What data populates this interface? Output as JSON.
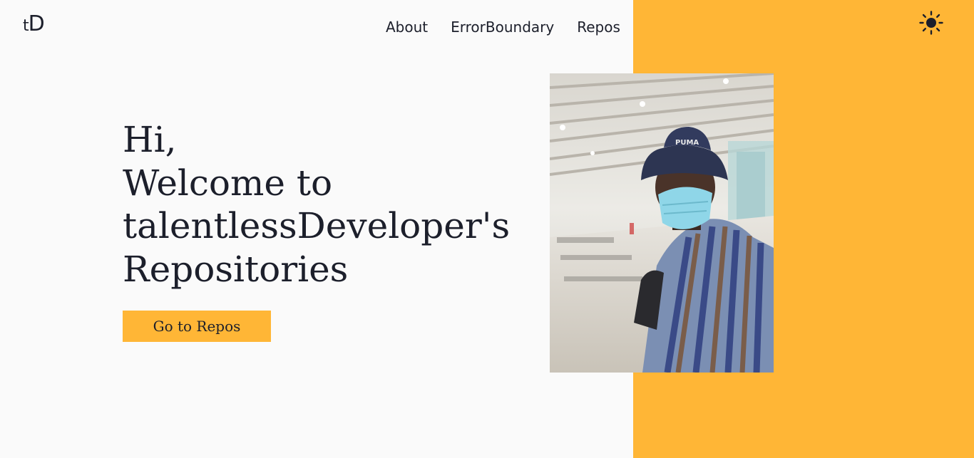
{
  "colors": {
    "accent": "#ffb636",
    "background": "#fafafa",
    "text": "#1c1f2b"
  },
  "header": {
    "logo_prefix": "t",
    "logo_main": "D",
    "nav": [
      {
        "label": "About"
      },
      {
        "label": "ErrorBoundary"
      },
      {
        "label": "Repos"
      }
    ],
    "theme_toggle_icon": "sun-icon"
  },
  "hero": {
    "lines": [
      "Hi,",
      "Welcome to",
      "talentlessDeveloper's",
      "Repositories"
    ],
    "cta_label": "Go to Repos"
  },
  "photo": {
    "icon": "profile-photo"
  }
}
